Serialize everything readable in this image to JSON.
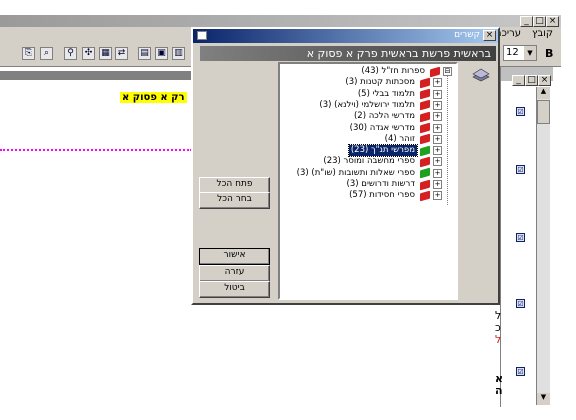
{
  "main_window": {
    "menu": [
      "קובץ",
      "עריכה"
    ],
    "toolbar_font_size": "12",
    "bold_label": "B",
    "doc_heading": "רק א פסוק א",
    "win_buttons": [
      "_",
      "□",
      "×"
    ]
  },
  "dialog": {
    "title": "קשרים",
    "close": "×",
    "header": "בראשית פרשת בראשית פרק א פסוק א",
    "tree": [
      {
        "label": "ספרות חז\"ל (43)",
        "color": "#d42020",
        "expander": "⊟"
      },
      {
        "label": "מסכתות קטנות (3)",
        "color": "#d42020",
        "expander": "+"
      },
      {
        "label": "תלמוד בבלי (5)",
        "color": "#d42020",
        "expander": "+"
      },
      {
        "label": "תלמוד ירושלמי (וילנא) (3)",
        "color": "#d42020",
        "expander": "+"
      },
      {
        "label": "מדרשי הלכה (2)",
        "color": "#d42020",
        "expander": "+"
      },
      {
        "label": "מדרשי אגדה (30)",
        "color": "#d42020",
        "expander": "+"
      },
      {
        "label": "זוהר (4)",
        "color": "#d42020",
        "expander": "+"
      },
      {
        "label": "מפרשי תנ\"ך (23)",
        "color": "#20a020",
        "expander": "+",
        "selected": true
      },
      {
        "label": "ספרי מחשבה ומוסר (23)",
        "color": "#d42020",
        "expander": "+"
      },
      {
        "label": "ספרי שאלות ותשובות (שו\"ת) (3)",
        "color": "#20a020",
        "expander": "+"
      },
      {
        "label": "דרשות ודרושים (3)",
        "color": "#d42020",
        "expander": "+"
      },
      {
        "label": "ספרי חסידות (57)",
        "color": "#d42020",
        "expander": "+"
      }
    ],
    "buttons": {
      "open_all": "פתח הכל",
      "select_all": "בחר הכל",
      "ok": "אישור",
      "help": "עזרה",
      "cancel": "ביטול"
    }
  },
  "right_panel": {
    "letters": [
      "ל",
      "כ",
      "ל"
    ],
    "footer_letters": [
      "א",
      "ה"
    ]
  }
}
